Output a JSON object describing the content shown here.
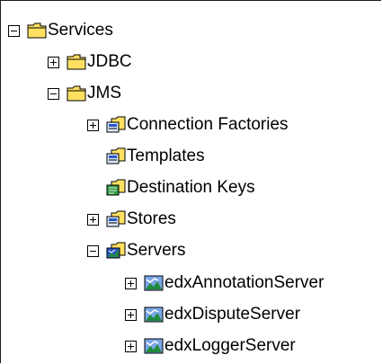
{
  "tree": {
    "services": {
      "label": "Services",
      "state": "expanded"
    },
    "jdbc": {
      "label": "JDBC",
      "state": "collapsed"
    },
    "jms": {
      "label": "JMS",
      "state": "expanded"
    },
    "connection_factories": {
      "label": "Connection Factories",
      "state": "collapsed"
    },
    "templates": {
      "label": "Templates"
    },
    "destination_keys": {
      "label": "Destination Keys"
    },
    "stores": {
      "label": "Stores",
      "state": "collapsed"
    },
    "servers": {
      "label": "Servers",
      "state": "expanded"
    },
    "server_items": [
      {
        "label": "edxAnnotationServer",
        "state": "collapsed"
      },
      {
        "label": "edxDisputeServer",
        "state": "collapsed"
      },
      {
        "label": "edxLoggerServer",
        "state": "collapsed"
      }
    ]
  },
  "icons": {
    "folder": "folder-icon",
    "jms_component_folder": "jms-folder-icon",
    "destination_keys": "destination-keys-icon",
    "jms_servers_folder": "jms-servers-folder-icon",
    "jms_server": "jms-server-icon"
  },
  "colors": {
    "folder_yellow": "#ffe060",
    "folder_outline": "#000000",
    "server_green": "#1f8a3a",
    "server_blue": "#2a58c8"
  }
}
